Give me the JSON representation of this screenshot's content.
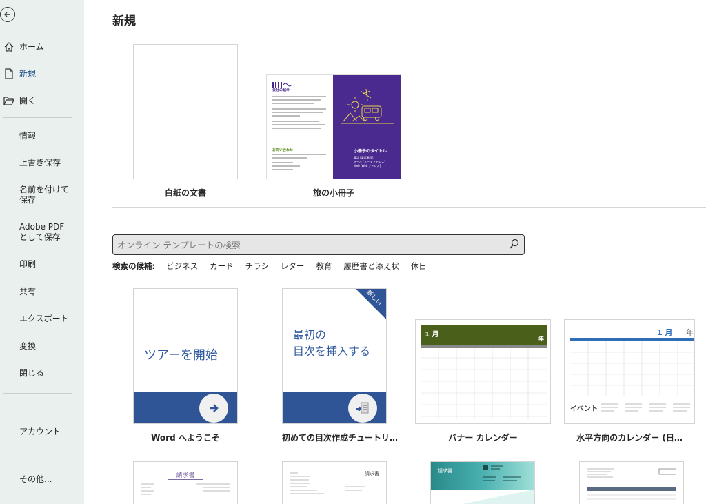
{
  "sidebar": {
    "top_items": [
      {
        "label": "ホーム",
        "icon": "home-icon"
      },
      {
        "label": "新規",
        "icon": "new-document-icon"
      },
      {
        "label": "開く",
        "icon": "folder-open-icon"
      }
    ],
    "middle_items": [
      "情報",
      "上書き保存",
      "名前を付けて保存",
      "Adobe PDF として保存",
      "印刷",
      "共有",
      "エクスポート",
      "変換",
      "閉じる"
    ],
    "account": "アカウント",
    "more": "その他..."
  },
  "main": {
    "title": "新規",
    "featured": [
      {
        "label": "白紙の文書"
      },
      {
        "label": "旅の小冊子"
      }
    ],
    "brochure": {
      "left_heading": "会社の紹介",
      "left_heading2": "お問い合わせ",
      "right_title": "小冊子のタイトル",
      "right_sub1": "電話 [電話番号]",
      "right_sub2": "メール [メール アドレス]",
      "right_sub3": "Web [Web アドレス]"
    },
    "search": {
      "placeholder": "オンライン テンプレートの検索"
    },
    "suggestions_label": "検索の候補:",
    "suggestions": [
      "ビジネス",
      "カード",
      "チラシ",
      "レター",
      "教育",
      "履歴書と添え状",
      "休日"
    ],
    "templates": [
      {
        "label": "Word へようこそ",
        "text": "ツアーを開始"
      },
      {
        "label": "初めての目次作成チュートリ…",
        "text1": "最初の",
        "text2": "目次を挿入する",
        "badge": "新しい"
      },
      {
        "label": "バナー カレンダー",
        "month": "1 月",
        "year": "年"
      },
      {
        "label": "水平方向のカレンダー (日…",
        "month": "1 月",
        "year": "年",
        "event": "イベント"
      }
    ],
    "bottom_row": [
      {
        "title": "請求書"
      },
      {
        "title": "請求書"
      },
      {
        "title": "請求書"
      },
      {
        "title": ""
      }
    ]
  },
  "colors": {
    "sidebar_bg": "#e9f0ee",
    "accent_blue": "#2f5597",
    "brochure_purple": "#4a2a8f",
    "banner_green": "#4a5f1a"
  }
}
